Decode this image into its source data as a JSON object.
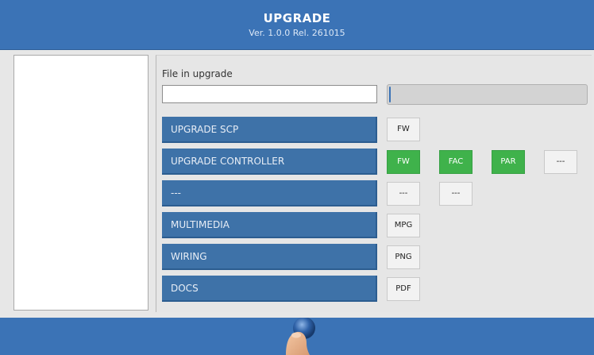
{
  "header": {
    "title": "UPGRADE",
    "version": "Ver. 1.0.0 Rel. 261015"
  },
  "file_section": {
    "label": "File in upgrade",
    "input_value": "",
    "progress_fraction": 0.0
  },
  "rows": [
    {
      "label": "UPGRADE SCP",
      "buttons": [
        "FW"
      ]
    },
    {
      "label": "UPGRADE CONTROLLER",
      "buttons": [
        "FW",
        "FAC",
        "PAR",
        "---"
      ]
    },
    {
      "label": "---",
      "buttons": [
        "---",
        "---"
      ]
    },
    {
      "label": "MULTIMEDIA",
      "buttons": [
        "MPG"
      ]
    },
    {
      "label": "WIRING",
      "buttons": [
        "PNG"
      ]
    },
    {
      "label": "DOCS",
      "buttons": [
        "PDF"
      ]
    }
  ],
  "colors": {
    "header_bg": "#3b73b6",
    "row_bg": "#3e72a8",
    "active_green": "#3fb24b"
  },
  "icons": {
    "footer_touch": "finger-touch-icon"
  }
}
